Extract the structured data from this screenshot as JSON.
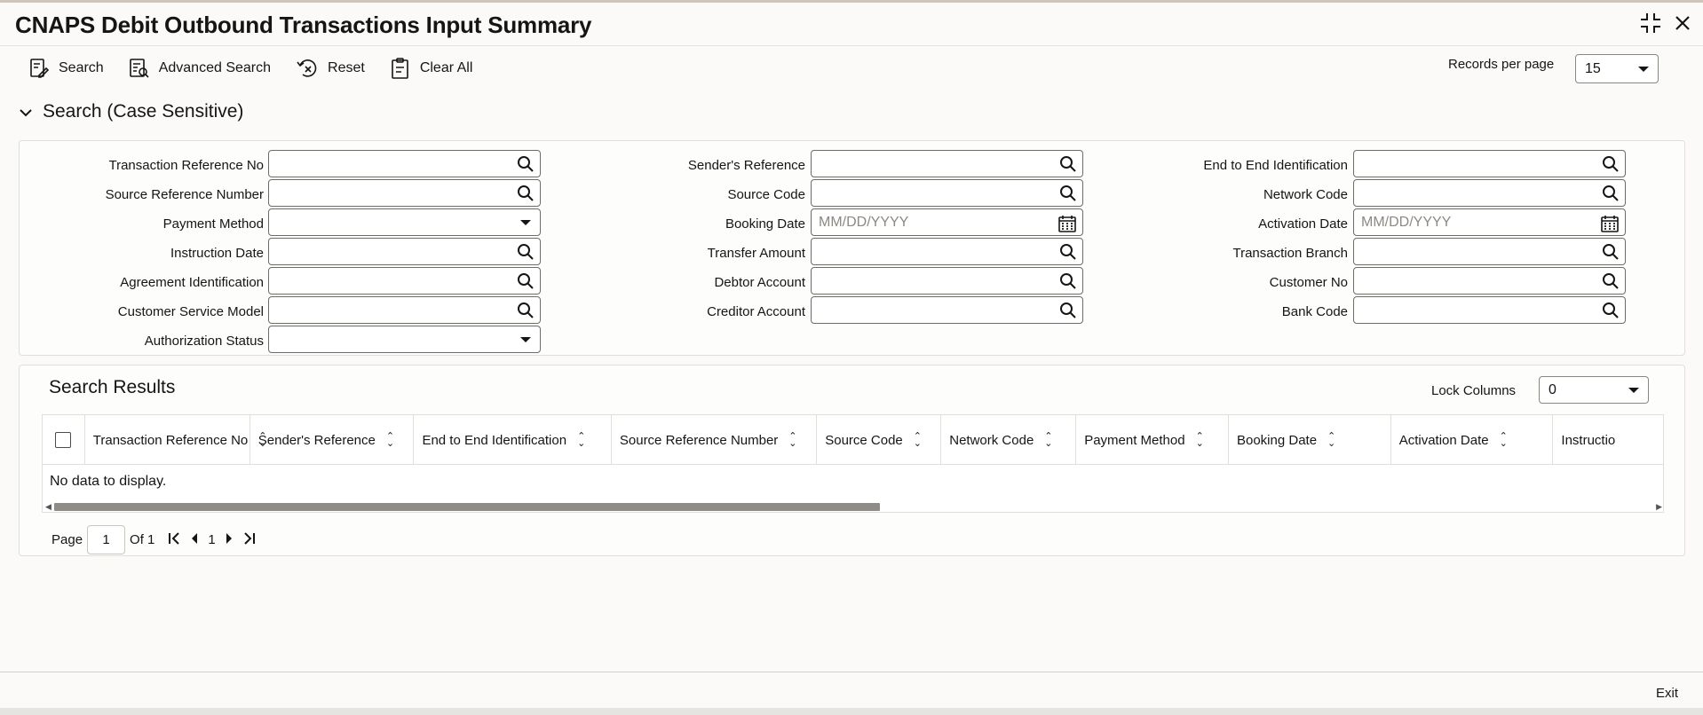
{
  "window": {
    "title": "CNAPS Debit Outbound Transactions Input Summary",
    "controls": [
      "collapse-icon",
      "close-icon"
    ]
  },
  "toolbar": {
    "search": "Search",
    "advanced_search": "Advanced Search",
    "reset": "Reset",
    "clear_all": "Clear All"
  },
  "records_per_page": {
    "label": "Records per page",
    "value": "15"
  },
  "search_section": {
    "title": "Search (Case Sensitive)",
    "fields": {
      "transaction_reference_no": {
        "label": "Transaction Reference No",
        "value": ""
      },
      "source_reference_number": {
        "label": "Source Reference Number",
        "value": ""
      },
      "payment_method": {
        "label": "Payment Method",
        "value": ""
      },
      "instruction_date": {
        "label": "Instruction Date",
        "value": ""
      },
      "agreement_identification": {
        "label": "Agreement Identification",
        "value": ""
      },
      "customer_service_model": {
        "label": "Customer Service Model",
        "value": ""
      },
      "authorization_status": {
        "label": "Authorization Status",
        "value": ""
      },
      "senders_reference": {
        "label": "Sender's Reference",
        "value": ""
      },
      "source_code": {
        "label": "Source Code",
        "value": ""
      },
      "booking_date": {
        "label": "Booking Date",
        "placeholder": "MM/DD/YYYY"
      },
      "transfer_amount": {
        "label": "Transfer Amount",
        "value": ""
      },
      "debtor_account": {
        "label": "Debtor Account",
        "value": ""
      },
      "creditor_account": {
        "label": "Creditor Account",
        "value": ""
      },
      "end_to_end_identification": {
        "label": "End to End Identification",
        "value": ""
      },
      "network_code": {
        "label": "Network Code",
        "value": ""
      },
      "activation_date": {
        "label": "Activation Date",
        "placeholder": "MM/DD/YYYY"
      },
      "transaction_branch": {
        "label": "Transaction Branch",
        "value": ""
      },
      "customer_no": {
        "label": "Customer No",
        "value": ""
      },
      "bank_code": {
        "label": "Bank Code",
        "value": ""
      }
    }
  },
  "results": {
    "title": "Search Results",
    "lock_columns": {
      "label": "Lock Columns",
      "value": "0"
    },
    "columns": [
      "Transaction Reference No",
      "Sender's Reference",
      "End to End Identification",
      "Source Reference Number",
      "Source Code",
      "Network Code",
      "Payment Method",
      "Booking Date",
      "Activation Date",
      "Instructio"
    ],
    "empty_message": "No data to display."
  },
  "pager": {
    "page_label": "Page",
    "page_value": "1",
    "of_label": "Of 1",
    "current": "1"
  },
  "footer": {
    "exit": "Exit"
  },
  "colors": {
    "text": "#161513",
    "border": "#6f6b66",
    "scroll_thumb": "#8f8b86"
  }
}
